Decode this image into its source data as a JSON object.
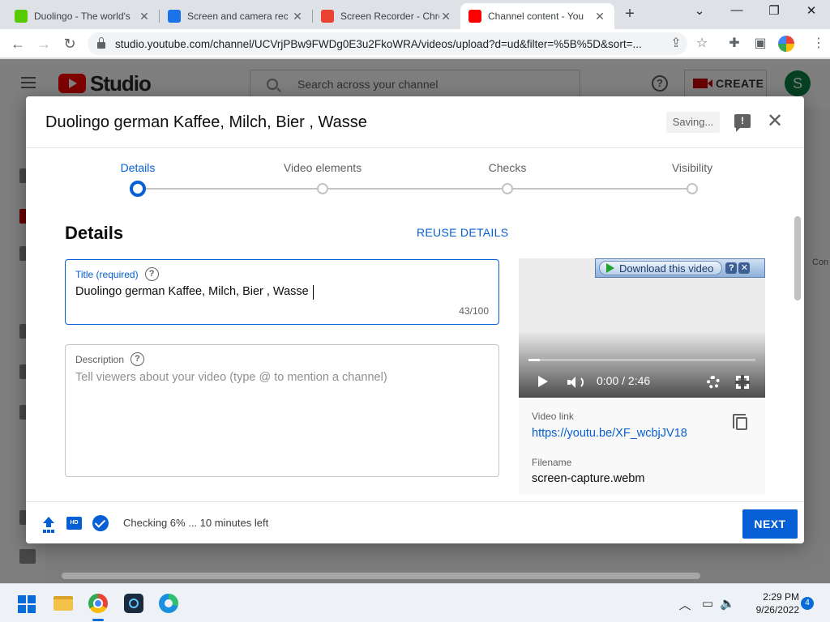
{
  "browser": {
    "tabs": [
      {
        "title": "Duolingo - The world's",
        "icon_color": "#58cc02"
      },
      {
        "title": "Screen and camera rec",
        "icon_color": "#1a73e8"
      },
      {
        "title": "Screen Recorder - Chro",
        "icon_color": "#ea4335"
      },
      {
        "title": "Channel content - You",
        "icon_color": "#ff0000"
      }
    ],
    "tab_close_glyph": "✕",
    "new_tab_glyph": "+",
    "url": "studio.youtube.com/channel/UCVrjPBw9FWDg0E3u2FkoWRA/videos/upload?d=ud&filter=%5B%5D&sort=..."
  },
  "studio": {
    "logo_text": "Studio",
    "search_placeholder": "Search across your channel",
    "help_glyph": "?",
    "create_label": "CREATE",
    "avatar_letter": "S"
  },
  "modal": {
    "title": "Duolingo german Kaffee, Milch, Bier , Wasse",
    "saving_label": "Saving...",
    "feedback_glyph": "!",
    "close_glyph": "✕",
    "steps": [
      "Details",
      "Video elements",
      "Checks",
      "Visibility"
    ],
    "active_step": 0,
    "details_heading": "Details",
    "reuse_label": "REUSE DETAILS",
    "title_field": {
      "label": "Title (required)",
      "value": "Duolingo german Kaffee, Milch, Bier , Wasse",
      "char_count": "43/100"
    },
    "description_field": {
      "label": "Description",
      "placeholder": "Tell viewers about your video (type @ to mention a channel)"
    },
    "help_glyph": "?",
    "video": {
      "download_label": "Download this video",
      "download_help": "?",
      "download_close": "✕",
      "time": "0:00 / 2:46",
      "progress_fraction": 0.05,
      "link_label": "Video link",
      "link": "https://youtu.be/XF_wcbjJV18",
      "filename_label": "Filename",
      "filename": "screen-capture.webm"
    },
    "footer": {
      "hd_text": "HD",
      "status": "Checking 6% ... 10 minutes left",
      "next_label": "NEXT"
    }
  },
  "outside_text": "Con",
  "taskbar": {
    "time": "2:29 PM",
    "date": "9/26/2022",
    "notification_count": "4",
    "tray_chevron": "︿"
  },
  "colors": {
    "accent_blue": "#065fd4",
    "youtube_red": "#ff0000",
    "avatar_green": "#0b8043"
  }
}
